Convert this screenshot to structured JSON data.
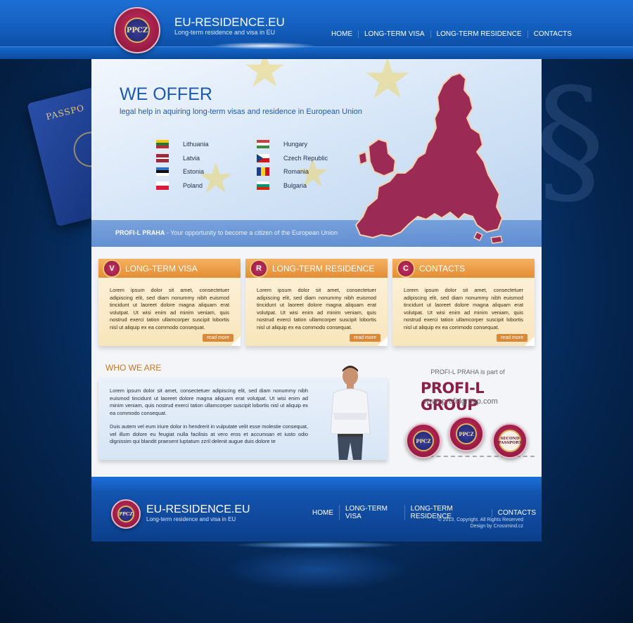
{
  "site": {
    "title": "EU-RESIDENCE.EU",
    "tagline": "Long-term residence and visa in EU",
    "seal_label": "PPCZ"
  },
  "nav": [
    {
      "label": "HOME"
    },
    {
      "label": "LONG-TERM VISA"
    },
    {
      "label": "LONG-TERM RESIDENCE"
    },
    {
      "label": "CONTACTS"
    }
  ],
  "decor": {
    "passport_label": "PASSPO"
  },
  "hero": {
    "title": "WE OFFER",
    "subtitle": "legal help in aquiring long-term visas and residence in European Union",
    "countries": [
      {
        "name": "Lithuania",
        "colors": [
          "#f7c600",
          "#1e7a3c",
          "#c1272d"
        ]
      },
      {
        "name": "Latvia",
        "colors": [
          "#9e2a3c",
          "#ffffff",
          "#9e2a3c"
        ]
      },
      {
        "name": "Estonia",
        "colors": [
          "#2f6fc4",
          "#111111",
          "#ffffff"
        ]
      },
      {
        "name": "Poland",
        "colors": [
          "#ffffff",
          "#d81e3a"
        ]
      },
      {
        "name": "Hungary",
        "colors": [
          "#d43a3a",
          "#ffffff",
          "#3d8a3f"
        ]
      },
      {
        "name": "Czech Republic",
        "colors": [
          "#ffffff",
          "#d7141a"
        ],
        "triangle": "#11457e"
      },
      {
        "name": "Romania",
        "colors": [
          "#1d3c96",
          "#fcd116",
          "#ce1126"
        ],
        "vertical": true
      },
      {
        "name": "Bulgaria",
        "colors": [
          "#ffffff",
          "#00966e",
          "#d62612"
        ]
      }
    ],
    "band_brand": "PROFI-L PRAHA",
    "band_text": " - Your opportunity to become a citizen of the European Union"
  },
  "boxes": [
    {
      "badge": "V",
      "title": "LONG-TERM VISA",
      "text": "Lorem ipsum dolor sit amet, consectetuer adipiscing elit, sed diam nonummy nibh euismod tincidunt ut laoreet dolore magna aliquam erat volutpat. Ut wisi enim ad minim veniam, quis nostrud exerci tation ullamcorper suscipit lobortis nisl ut aliquip ex ea commodo consequat.",
      "link": "read more"
    },
    {
      "badge": "R",
      "title": "LONG-TERM RESIDENCE",
      "text": "Lorem ipsum dolor sit amet, consectetuer adipiscing elit, sed diam nonummy nibh euismod tincidunt ut laoreet dolore magna aliquam erat volutpat. Ut wisi enim ad minim veniam, quis nostrud exerci tation ullamcorper suscipit lobortis nisl ut aliquip ex ea commodo consequat.",
      "link": "read more"
    },
    {
      "badge": "C",
      "title": "CONTACTS",
      "text": "Lorem ipsum dolor sit amet, consectetuer adipiscing elit, sed diam nonummy nibh euismod tincidunt ut laoreet dolore magna aliquam erat volutpat. Ut wisi enim ad minim veniam, quis nostrud exerci tation ullamcorper suscipit lobortis nisl ut aliquip ex ea commodo consequat.",
      "link": "read more"
    }
  ],
  "who": {
    "title": "WHO WE ARE",
    "paragraphs": [
      "Lorem ipsum dolor sit amet, consectetuer adipiscing elit, sed diam nonummy nibh euismod tincidunt ut laoreet dolore magna aliquam erat volutpat. Ut wisi enim ad minim veniam, quis nostrud exerci tation ullamcorper suscipit lobortis nisl ut aliquip ex ea commodo consequat.",
      "Duis autem vel eum iriure dolor in hendrerit in vulputate velit esse molestie consequat, vel illum dolore eu feugiat nulla facilisis at vero eros et accumsan et iusto odio dignissim qui blandit praesent luptatum zzril delenit augue duis dolore te"
    ]
  },
  "group": {
    "part_of": "PROFI-L PRAHA is part of",
    "name": "PROFI-L GROUP",
    "url": "www.profi-lgroup.com",
    "medals": [
      "PPCZ",
      "PPCZ",
      "SECOND PASSPORT"
    ]
  },
  "footer": {
    "title": "EU-RESIDENCE.EU",
    "tagline": "Long-term residence and visa in EU",
    "copyright": "© 2013. Copyright. All Rights Reserved",
    "design": "Design by Crossmind.cz"
  }
}
